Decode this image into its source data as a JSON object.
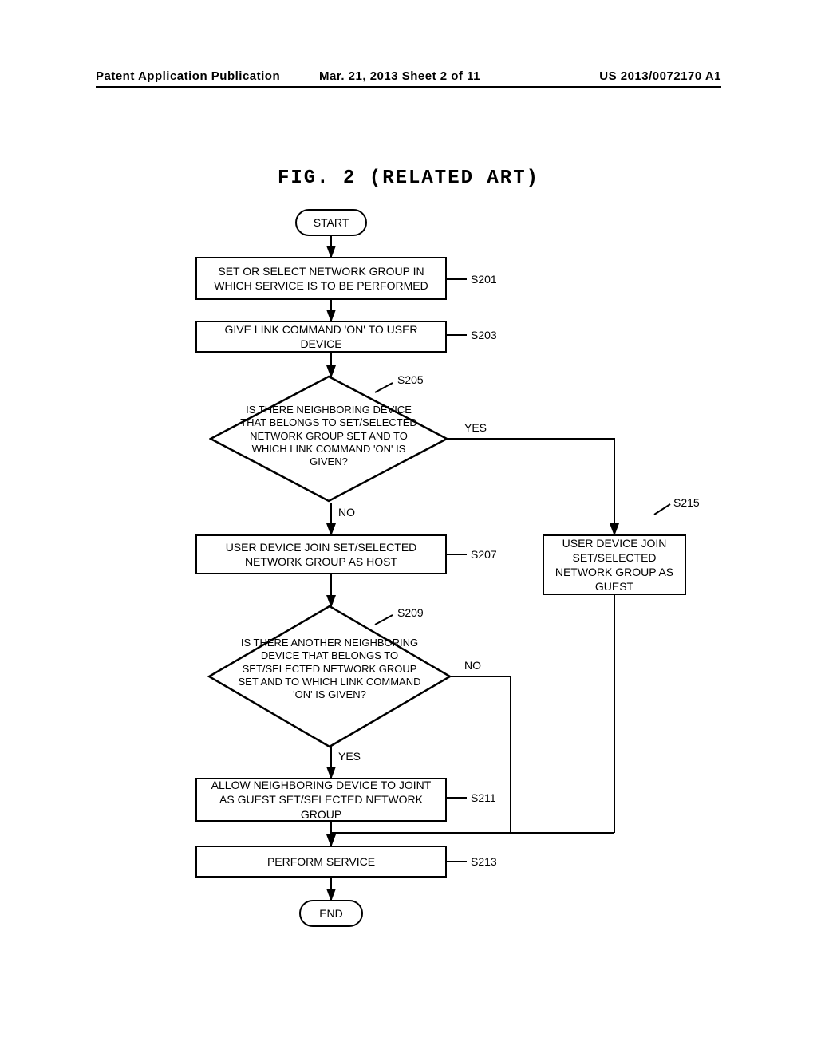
{
  "header": {
    "left": "Patent Application Publication",
    "mid": "Mar. 21, 2013  Sheet 2 of 11",
    "right": "US 2013/0072170 A1"
  },
  "figure": {
    "title": "FIG. 2 (RELATED ART)"
  },
  "nodes": {
    "start": "START",
    "s201": "SET OR SELECT NETWORK GROUP IN WHICH SERVICE IS TO BE PERFORMED",
    "s203": "GIVE LINK COMMAND 'ON' TO USER DEVICE",
    "s205": "IS THERE NEIGHBORING DEVICE THAT BELONGS TO SET/SELECTED NETWORK GROUP SET AND TO WHICH LINK COMMAND 'ON' IS GIVEN?",
    "s207": "USER DEVICE JOIN SET/SELECTED NETWORK GROUP AS HOST",
    "s209": "IS THERE ANOTHER NEIGHBORING DEVICE THAT BELONGS TO SET/SELECTED NETWORK GROUP SET AND TO WHICH LINK COMMAND 'ON' IS GIVEN?",
    "s211": "ALLOW NEIGHBORING DEVICE TO JOINT AS GUEST SET/SELECTED NETWORK GROUP",
    "s213": "PERFORM SERVICE",
    "s215": "USER DEVICE JOIN SET/SELECTED NETWORK GROUP AS GUEST",
    "end": "END"
  },
  "labels": {
    "s201": "S201",
    "s203": "S203",
    "s205": "S205",
    "s207": "S207",
    "s209": "S209",
    "s211": "S211",
    "s213": "S213",
    "s215": "S215"
  },
  "edges": {
    "yes": "YES",
    "no": "NO"
  }
}
